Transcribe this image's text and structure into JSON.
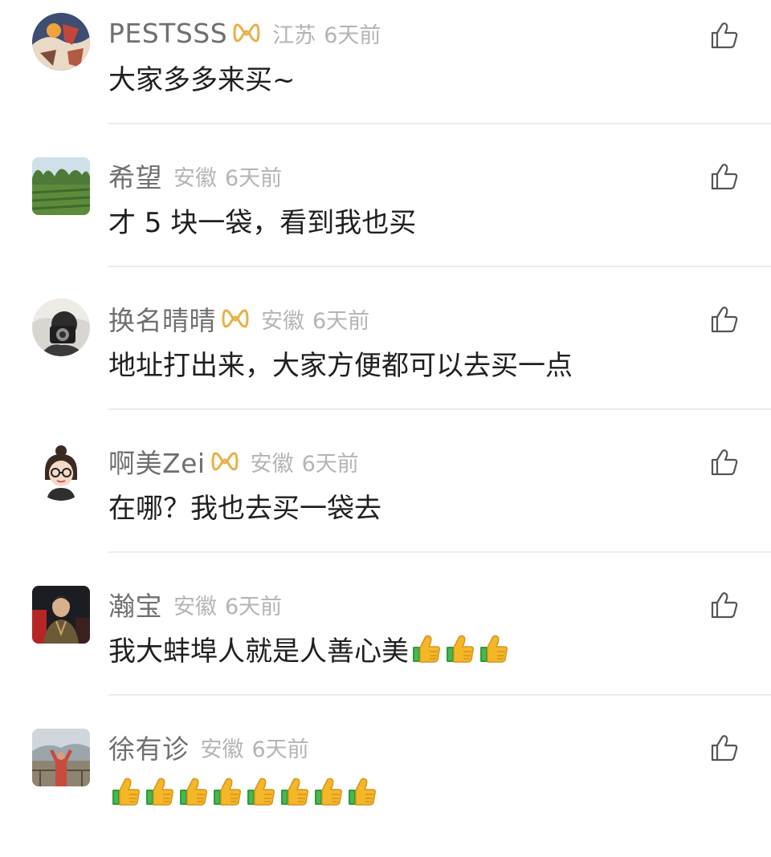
{
  "comments": [
    {
      "username": "PESTSSS",
      "has_badge": true,
      "location": "江苏",
      "time": "6天前",
      "text": "大家多多来买~",
      "emoji_count": 0,
      "avatar": "abstract-illustration-avatar"
    },
    {
      "username": "希望",
      "has_badge": false,
      "location": "安徽",
      "time": "6天前",
      "text": "才 5 块一袋，看到我也买",
      "emoji_count": 0,
      "avatar": "field-photo-avatar"
    },
    {
      "username": "换名晴晴",
      "has_badge": true,
      "location": "安徽",
      "time": "6天前",
      "text": "地址打出来，大家方便都可以去买一点",
      "emoji_count": 0,
      "avatar": "camera-person-avatar"
    },
    {
      "username": "啊美Zei",
      "has_badge": true,
      "location": "安徽",
      "time": "6天前",
      "text": "在哪？我也去买一袋去",
      "emoji_count": 0,
      "avatar": "cartoon-girl-avatar"
    },
    {
      "username": "瀚宝",
      "has_badge": false,
      "location": "安徽",
      "time": "6天前",
      "text": "我大蚌埠人就是人善心美",
      "emoji_count": 3,
      "avatar": "person-photo-avatar"
    },
    {
      "username": "徐有诊",
      "has_badge": false,
      "location": "安徽",
      "time": "6天前",
      "text": "",
      "emoji_count": 8,
      "avatar": "outdoor-person-avatar"
    }
  ],
  "icons": {
    "like": "thumbs-up-outline-icon",
    "badge": "vip-badge-icon",
    "emoji": "thumbs-up-emoji"
  },
  "colors": {
    "username": "#6f6f6f",
    "meta": "#b4b4b4",
    "text": "#1f1f1f",
    "badge": "#e8b04a",
    "divider": "#ececec",
    "like_icon": "#555555"
  }
}
